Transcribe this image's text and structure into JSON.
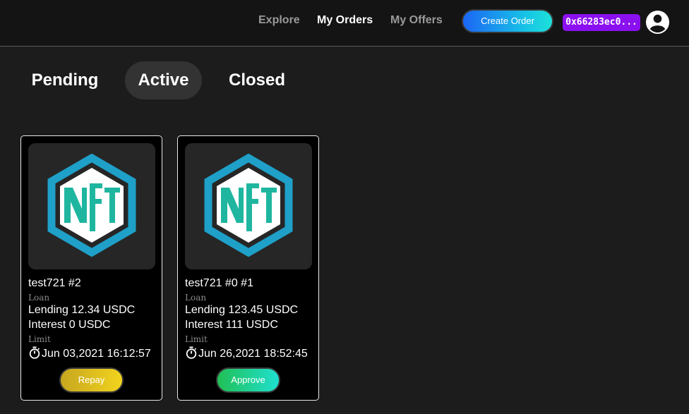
{
  "header": {
    "nav": {
      "explore": "Explore",
      "my_orders": "My Orders",
      "my_offers": "My Offers"
    },
    "create_order_label": "Create Order",
    "wallet_address": "0x66283ec0...",
    "avatar_icon": "account-circle-icon"
  },
  "tabs": {
    "pending": "Pending",
    "active": "Active",
    "closed": "Closed",
    "selected": "Active"
  },
  "colors": {
    "background": "#1c1c1c",
    "header_background": "#141414",
    "wallet_badge": "#8b10f0",
    "nft_logo": "#1ea0c8",
    "nft_letters": "#1fb6a0",
    "repay_gradient": [
      "#c7a61f",
      "#f2d41e"
    ],
    "approve_gradient": [
      "#21c055",
      "#1fe0d0"
    ],
    "create_order_gradient": [
      "#1c66f5",
      "#1ee0d9"
    ]
  },
  "orders": [
    {
      "title": "test721 #2",
      "loan_label": "Loan",
      "lending": "Lending 12.34 USDC",
      "interest": "Interest 0 USDC",
      "limit_label": "Limit",
      "limit_date": "Jun 03,2021 16:12:57",
      "action": "Repay",
      "image_icon": "nft-logo-icon"
    },
    {
      "title": "test721 #0 #1",
      "loan_label": "Loan",
      "lending": "Lending 123.45 USDC",
      "interest": "Interest 111 USDC",
      "limit_label": "Limit",
      "limit_date": "Jun 26,2021 18:52:45",
      "action": "Approve",
      "image_icon": "nft-logo-icon"
    }
  ]
}
